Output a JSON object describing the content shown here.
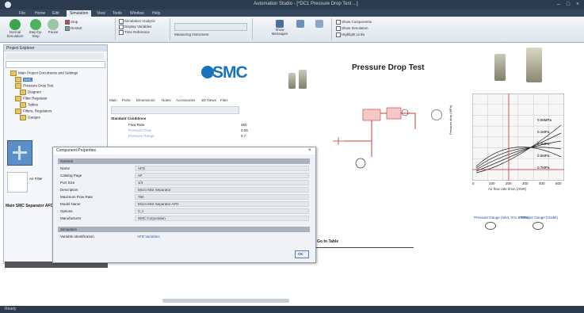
{
  "window": {
    "title": "Automation Studio - [*DC1 Pressure Drop Test ...]"
  },
  "tabs": [
    "File",
    "Home",
    "Edit",
    "Simulation",
    "View",
    "Tools",
    "Window",
    "Help"
  ],
  "active_tab": "Simulation",
  "ribbon": {
    "buttons": [
      "Normal Simulation",
      "Step-by-Step",
      "Pause",
      "Stop",
      "Restart"
    ],
    "small_items": [
      "Simulation Analysis",
      "Display Variables",
      "Time Reference",
      "Measuring Instrument",
      "Show Messages"
    ],
    "right_items": [
      "Show Components",
      "Show Simulation",
      "Highlight Links"
    ]
  },
  "left_panel": {
    "title": "Project Explorer",
    "tree": [
      {
        "label": "Main Project Documents and Settings",
        "selected": false
      },
      {
        "label": "SMC",
        "selected": true
      },
      {
        "label": "Pressure Drop Test",
        "selected": false
      },
      {
        "label": "Diagram",
        "selected": false
      },
      {
        "label": "Filter Regulator",
        "selected": false
      },
      {
        "label": "Tables",
        "selected": false
      },
      {
        "label": "Filters, Regulators",
        "selected": false
      },
      {
        "label": "Gauges",
        "selected": false
      }
    ],
    "component": {
      "name": "Main SMC Separator AFD",
      "caption": "Air Filter"
    }
  },
  "center": {
    "logo_text": "SMC",
    "table_tabs": [
      "Main",
      "Ports",
      "Dimensions",
      "Notes",
      "Accessories",
      "3D Views",
      "Files"
    ],
    "table_section": "Standard Conditions",
    "rows": [
      {
        "name": "Flow Rate",
        "value": "460"
      },
      {
        "name": "Pressure Drop",
        "value": "0.05"
      },
      {
        "name": "Pressure Range",
        "value": "0.7"
      }
    ]
  },
  "dialog": {
    "title": "Component Properties",
    "section1": "General",
    "fields": [
      {
        "label": "Name",
        "value": "AFD"
      },
      {
        "label": "Catalog Page",
        "value": "AF"
      },
      {
        "label": "Port Size",
        "value": "1/4"
      },
      {
        "label": "Description",
        "value": "Micro Mist Separator"
      },
      {
        "label": "Maximum Flow Rate",
        "value": "750"
      },
      {
        "label": "Model Name",
        "value": "Micro Mist Separator AFD"
      },
      {
        "label": "Options",
        "value": "C,J"
      },
      {
        "label": "Manufacturer",
        "value": "SMC Corporation"
      }
    ],
    "section2": "Simulation",
    "sim_field": {
      "label": "Variable Identification",
      "value": "AFD Variables"
    },
    "ok_label": "OK"
  },
  "doc": {
    "title": "Pressure Drop Test",
    "link_label": "Go to Table",
    "gauges": [
      "Pressure Gauge (Inlet, 0 to 1 MPa)",
      "Pressure Gauge (Outlet)"
    ]
  },
  "chart_data": {
    "type": "line",
    "xlabel": "Air flow rate l/min (ANR)",
    "ylabel": "Pressure drop (MPa)",
    "series": [
      {
        "name": "0.05MPa",
        "values": []
      },
      {
        "name": "0.1MPa",
        "values": []
      },
      {
        "name": "0.3MPa",
        "values": []
      },
      {
        "name": "0.5MPa",
        "values": []
      },
      {
        "name": "0.7MPa",
        "values": []
      }
    ],
    "xticks": [
      "0",
      "100",
      "200",
      "300",
      "400",
      "500"
    ]
  },
  "statusbar": {
    "left": "Ready"
  }
}
